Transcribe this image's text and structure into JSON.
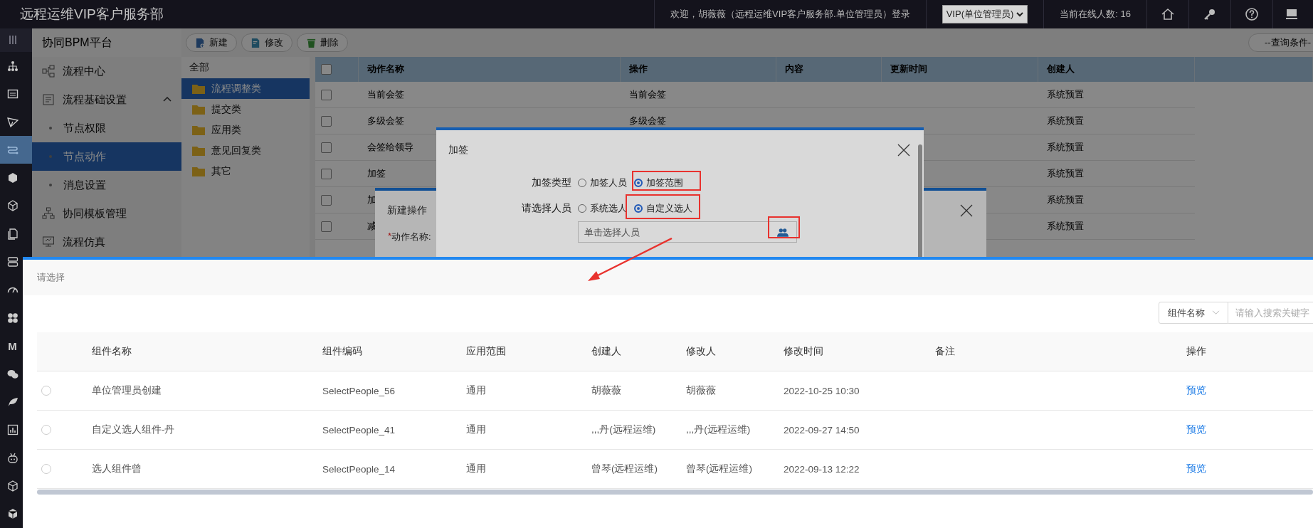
{
  "top_bar": {
    "title": "远程运维VIP客户服务部",
    "welcome": "欢迎，胡薇薇（远程运维VIP客户服务部.单位管理员）登录",
    "role_select": "VIP(单位管理员)",
    "online_count": "当前在线人数: 16"
  },
  "rail": [
    {
      "kind": "menu",
      "selected": false
    },
    {
      "kind": "hierarchy",
      "selected": false
    },
    {
      "kind": "panel",
      "selected": false
    },
    {
      "kind": "send",
      "selected": false
    },
    {
      "kind": "flow",
      "selected": true
    },
    {
      "kind": "hexagon",
      "selected": false
    },
    {
      "kind": "cube",
      "selected": false
    },
    {
      "kind": "document",
      "selected": false
    },
    {
      "kind": "server",
      "selected": false
    },
    {
      "kind": "gauge",
      "selected": false
    },
    {
      "kind": "clover",
      "selected": false
    },
    {
      "kind": "letter",
      "text": "M",
      "selected": false
    },
    {
      "kind": "chat",
      "selected": false
    },
    {
      "kind": "leaf",
      "selected": false
    },
    {
      "kind": "chart",
      "selected": false
    },
    {
      "kind": "robot",
      "selected": false
    },
    {
      "kind": "cube",
      "selected": false
    },
    {
      "kind": "box",
      "selected": false
    }
  ],
  "sidebar": {
    "title": "协同BPM平台",
    "items": [
      {
        "label": "流程中心",
        "selected": false
      },
      {
        "label": "流程基础设置",
        "selected": false,
        "expanded": true,
        "children": [
          {
            "label": "节点权限",
            "selected": false
          },
          {
            "label": "节点动作",
            "selected": true
          },
          {
            "label": "消息设置",
            "selected": false
          }
        ]
      },
      {
        "label": "协同模板管理",
        "selected": false
      },
      {
        "label": "流程仿真",
        "selected": false
      }
    ]
  },
  "toolbar": {
    "buttons": [
      "新建",
      "修改",
      "删除"
    ],
    "query_button": "--查询条件-"
  },
  "category_tree": {
    "root": "全部",
    "items": [
      {
        "label": "流程调整类",
        "selected": true
      },
      {
        "label": "提交类",
        "selected": false
      },
      {
        "label": "应用类",
        "selected": false
      },
      {
        "label": "意见回复类",
        "selected": false
      },
      {
        "label": "其它",
        "selected": false
      }
    ]
  },
  "action_table": {
    "header_checked": false,
    "columns": [
      "动作名称",
      "操作",
      "内容",
      "更新时间",
      "创建人"
    ],
    "rows": [
      {
        "checked": false,
        "name": "当前会签",
        "operation": "当前会签",
        "creator": "系统预置"
      },
      {
        "checked": false,
        "name": "多级会签",
        "operation": "多级会签",
        "creator": "系统预置"
      },
      {
        "checked": false,
        "name": "会签给领导",
        "creator": "系统预置"
      },
      {
        "checked": false,
        "name": "加签",
        "creator": "系统预置"
      },
      {
        "checked": false,
        "name": "加",
        "creator": "系统预置"
      },
      {
        "checked": false,
        "name": "减",
        "creator": "系统预置"
      }
    ]
  },
  "new_action_dialog": {
    "title": "新建操作",
    "required_mark": "*",
    "field_label": "动作名称:"
  },
  "add_sign_dialog": {
    "title": "加签",
    "groups": [
      {
        "label": "加签类型",
        "options": [
          {
            "label": "加签人员",
            "selected": false
          },
          {
            "label": "加签范围",
            "selected": true
          }
        ]
      },
      {
        "label": "请选择人员",
        "options": [
          {
            "label": "系统选人",
            "selected": false
          },
          {
            "label": "自定义选人",
            "selected": true
          }
        ]
      }
    ],
    "people_field": {
      "placeholder": "单击选择人员"
    }
  },
  "select_dialog": {
    "title": "请选择",
    "search": {
      "field": "组件名称",
      "placeholder": "请输入搜索关键字"
    },
    "columns": [
      "组件名称",
      "组件编码",
      "应用范围",
      "创建人",
      "修改人",
      "修改时间",
      "备注",
      "操作"
    ],
    "rows": [
      {
        "selected": false,
        "name": "单位管理员创建",
        "code": "SelectPeople_56",
        "scope": "通用",
        "creator": "胡薇薇",
        "modifier": "胡薇薇",
        "modified": "2022-10-25 10:30",
        "action": "预览"
      },
      {
        "selected": false,
        "name": "自定义选人组件-丹",
        "code": "SelectPeople_41",
        "scope": "通用",
        "creator": ",,,丹(远程运维)",
        "modifier": ",,,丹(远程运维)",
        "modified": "2022-09-27 14:50",
        "action": "预览"
      },
      {
        "selected": false,
        "name": "选人组件曾",
        "code": "SelectPeople_14",
        "scope": "通用",
        "creator": "曾琴(远程运维)",
        "modifier": "曾琴(远程运维)",
        "modified": "2022-09-13 12:22",
        "action": "预览"
      }
    ]
  }
}
